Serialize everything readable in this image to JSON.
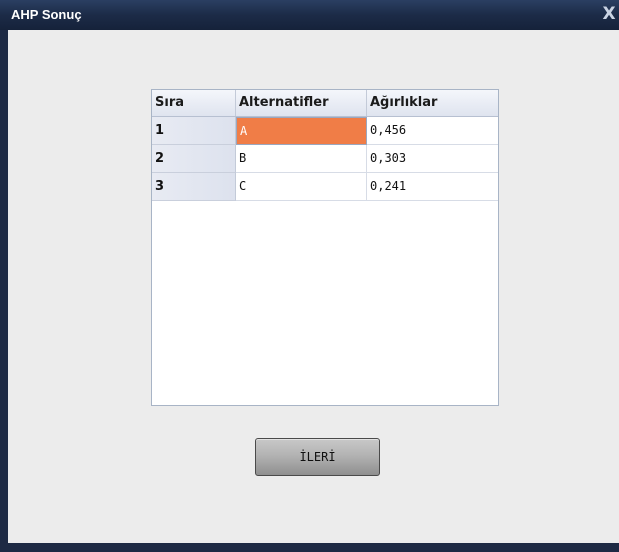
{
  "window": {
    "title": "AHP Sonuç",
    "close_glyph": "X"
  },
  "grid": {
    "columns": [
      "Sıra",
      "Alternatifler",
      "Ağırlıklar"
    ],
    "rows": [
      {
        "sira": "1",
        "alternatif": "A",
        "agirlik": "0,456"
      },
      {
        "sira": "2",
        "alternatif": "B",
        "agirlik": "0,303"
      },
      {
        "sira": "3",
        "alternatif": "C",
        "agirlik": "0,241"
      }
    ],
    "selected_cell": "A",
    "selected_color": "#f07d47"
  },
  "buttons": {
    "next_label": "İLERİ"
  },
  "colors": {
    "titlebar": "#1c2b47",
    "client_background": "#ececec",
    "header_background": "#dfe4ef"
  }
}
